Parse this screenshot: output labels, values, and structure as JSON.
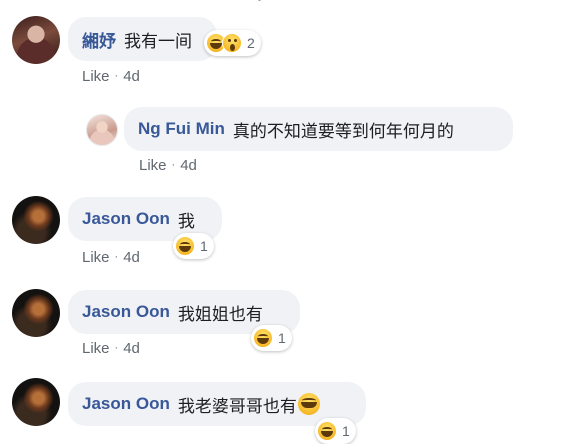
{
  "comments": [
    {
      "author": "緗妤",
      "text": "我有一间",
      "like_label": "Like",
      "separator": "·",
      "time": "4d",
      "reaction_count": "2",
      "reactions": [
        "haha-icon",
        "wow-icon"
      ]
    },
    {
      "author": "Ng Fui Min",
      "text": "真的不知道要等到何年何月的",
      "like_label": "Like",
      "separator": "·",
      "time": "4d"
    },
    {
      "author": "Jason Oon",
      "text": "我",
      "like_label": "Like",
      "separator": "·",
      "time": "4d",
      "reaction_count": "1",
      "reactions": [
        "haha-icon"
      ]
    },
    {
      "author": "Jason Oon",
      "text": "我姐姐也有",
      "like_label": "Like",
      "separator": "·",
      "time": "4d",
      "reaction_count": "1",
      "reactions": [
        "haha-icon"
      ]
    },
    {
      "author": "Jason Oon",
      "text": "我老婆哥哥也有",
      "inline_emoji": "laughing-tears-emoji",
      "reaction_count": "1",
      "reactions": [
        "haha-icon"
      ]
    }
  ],
  "colors": {
    "author": "#385898",
    "bubble": "#f0f2f5",
    "meta": "#606770",
    "reaction_yellow": "#f7b928"
  }
}
